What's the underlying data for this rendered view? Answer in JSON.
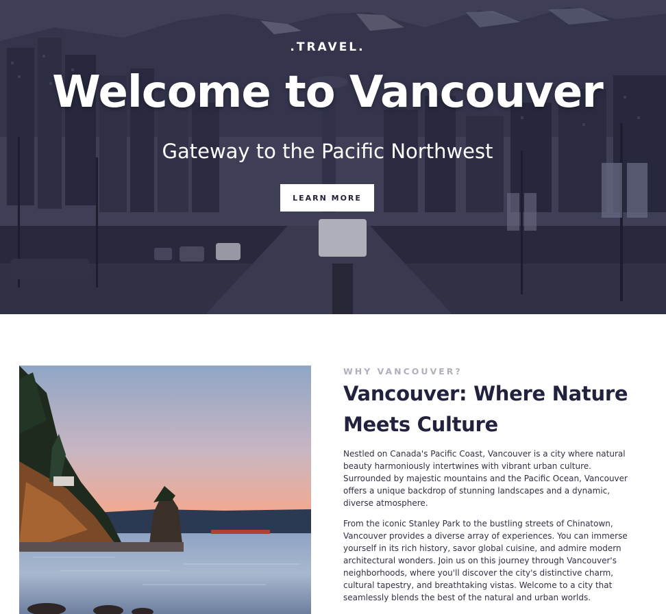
{
  "hero": {
    "kicker": ".TRAVEL.",
    "title": "Welcome to Vancouver",
    "subtitle": "Gateway to the Pacific Northwest",
    "button_label": "LEARN MORE"
  },
  "about": {
    "eyebrow": "WHY VANCOUVER?",
    "heading": "Vancouver: Where Nature Meets Culture",
    "paragraphs": [
      "Nestled on Canada's Pacific Coast, Vancouver is a city where natural beauty harmoniously intertwines with vibrant urban culture. Surrounded by majestic mountains and the Pacific Ocean, Vancouver offers a unique backdrop of stunning landscapes and a dynamic, diverse atmosphere.",
      "From the iconic Stanley Park to the bustling streets of Chinatown, Vancouver provides a diverse array of experiences. You can immerse yourself in its rich history, savor global cuisine, and admire modern architectural wonders. Join us on this journey through Vancouver's neighborhoods, where you'll discover the city's distinctive charm, cultural tapestry, and breathtaking vistas. Welcome to a city that seamlessly blends the best of the natural and urban worlds."
    ]
  },
  "colors": {
    "hero_overlay": "#2c2c45",
    "heading": "#22223e",
    "eyebrow": "#b0b0bc",
    "button_bg": "#ffffff"
  }
}
